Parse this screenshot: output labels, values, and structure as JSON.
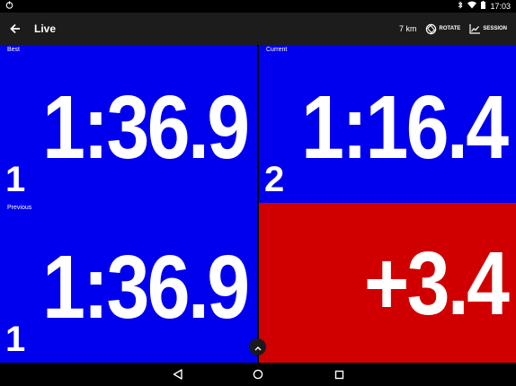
{
  "status_bar": {
    "time": "17:03",
    "icons": [
      "android-debug-icon",
      "bluetooth-icon",
      "wifi-icon",
      "battery-icon"
    ]
  },
  "app_bar": {
    "title": "Live",
    "distance": "7 km",
    "rotate_label": "ROTATE",
    "session_label": "SESSION"
  },
  "tiles": {
    "best": {
      "label": "Best",
      "time": "1:36.9",
      "lap": "1",
      "color": "#0000ee"
    },
    "current": {
      "label": "Current",
      "time": "1:16.4",
      "lap": "2",
      "color": "#0000ee"
    },
    "previous": {
      "label": "Previous",
      "time": "1:36.9",
      "lap": "1",
      "color": "#0000ee"
    },
    "delta": {
      "value": "+3.4",
      "color": "#d00000"
    }
  },
  "nav_bar": {
    "icons": [
      "back-nav-icon",
      "home-nav-icon",
      "recents-nav-icon"
    ]
  }
}
